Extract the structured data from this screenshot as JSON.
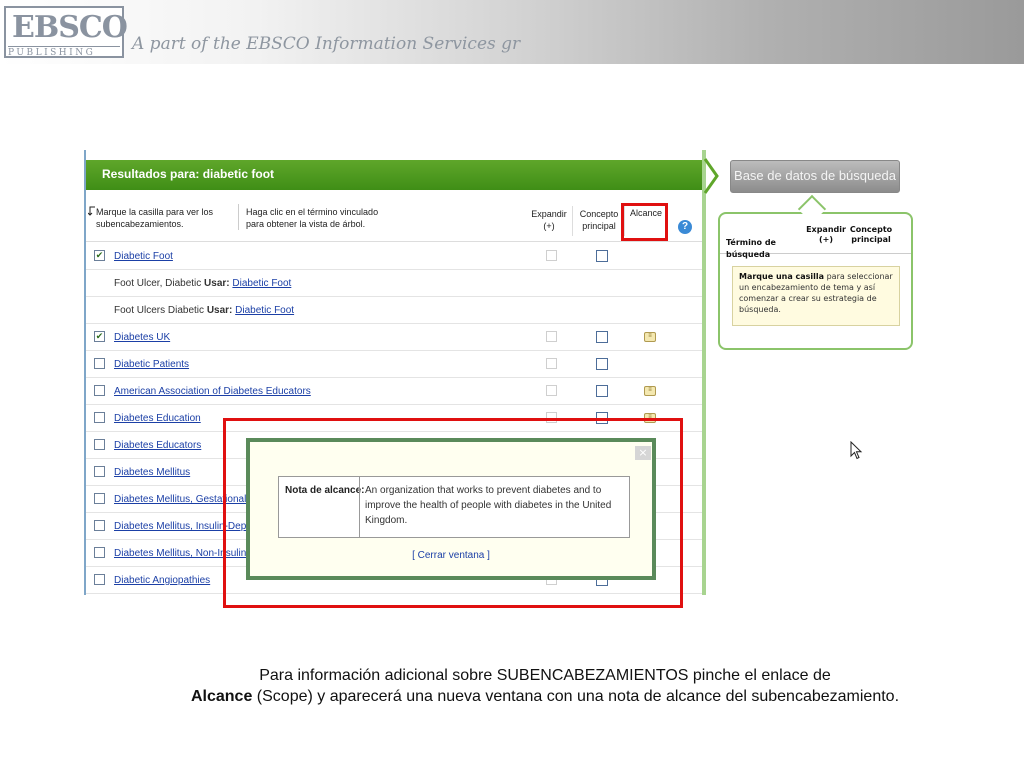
{
  "banner": {
    "logo_main": "EBSCO",
    "logo_sub": "PUBLISHING",
    "tagline": "A part of the EBSCO Information Services gr"
  },
  "results": {
    "header": "Resultados para: diabetic foot",
    "instruction_check": "Marque la casilla para ver los subencabezamientos.",
    "instruction_link": "Haga clic en el término vinculado para obtener la vista de árbol.",
    "col_expand": "Expandir (+)",
    "col_concept": "Concepto principal",
    "col_scope": "Alcance",
    "rows": [
      {
        "type": "link",
        "checked": true,
        "label": "Diabetic Foot",
        "scope": false
      },
      {
        "type": "use",
        "label": "Foot Ulcer, Diabetic",
        "use_word": "Usar:",
        "target": "Diabetic Foot"
      },
      {
        "type": "use",
        "label": "Foot Ulcers Diabetic",
        "use_word": "Usar:",
        "target": "Diabetic Foot"
      },
      {
        "type": "link",
        "checked": true,
        "label": "Diabetes UK",
        "scope": true
      },
      {
        "type": "link",
        "checked": false,
        "label": "Diabetic Patients",
        "scope": false
      },
      {
        "type": "link",
        "checked": false,
        "label": "American Association of Diabetes Educators",
        "scope": true
      },
      {
        "type": "link",
        "checked": false,
        "label": "Diabetes Education",
        "scope": true
      },
      {
        "type": "link",
        "checked": false,
        "label": "Diabetes Educators",
        "scope": false
      },
      {
        "type": "link",
        "checked": false,
        "label": "Diabetes Mellitus",
        "scope": false
      },
      {
        "type": "link",
        "checked": false,
        "label": "Diabetes Mellitus, Gestational",
        "scope": false
      },
      {
        "type": "link",
        "checked": false,
        "label": "Diabetes Mellitus, Insulin-Dependent",
        "scope": false
      },
      {
        "type": "link",
        "checked": false,
        "label": "Diabetes Mellitus, Non-Insulin-Dependent",
        "scope": false
      },
      {
        "type": "link",
        "checked": false,
        "label": "Diabetic Angiopathies",
        "scope": false
      }
    ]
  },
  "popup": {
    "close": "×",
    "note_label": "Nota de alcance:",
    "note_text": "An organization that works to prevent diabetes and to improve the health of people with diabetes in the United Kingdom.",
    "close_link": "[ Cerrar ventana ]"
  },
  "sidebar": {
    "db_button": "Base de datos de búsqueda",
    "term_label": "Término de",
    "term_label2": "búsqueda",
    "expand": "Expandir (+)",
    "concept": "Concepto principal",
    "tip_bold": "Marque una casilla",
    "tip_text": " para seleccionar un encabezamiento de tema y así comenzar a crear su estrategia de búsqueda."
  },
  "caption": {
    "line1": "Para información adicional sobre SUBENCABEZAMIENTOS pinche el enlace de",
    "bold": "Alcance",
    "line2": " (Scope) y aparecerá una nueva ventana con una nota de alcance del subencabezamiento."
  },
  "colors": {
    "header_green": "#4a9a1e",
    "link_blue": "#1b3fa6",
    "highlight_red": "#e01010"
  },
  "icons": [
    "help-icon",
    "scope-note-icon",
    "close-icon",
    "mouse-cursor-icon",
    "arrow-icon"
  ]
}
